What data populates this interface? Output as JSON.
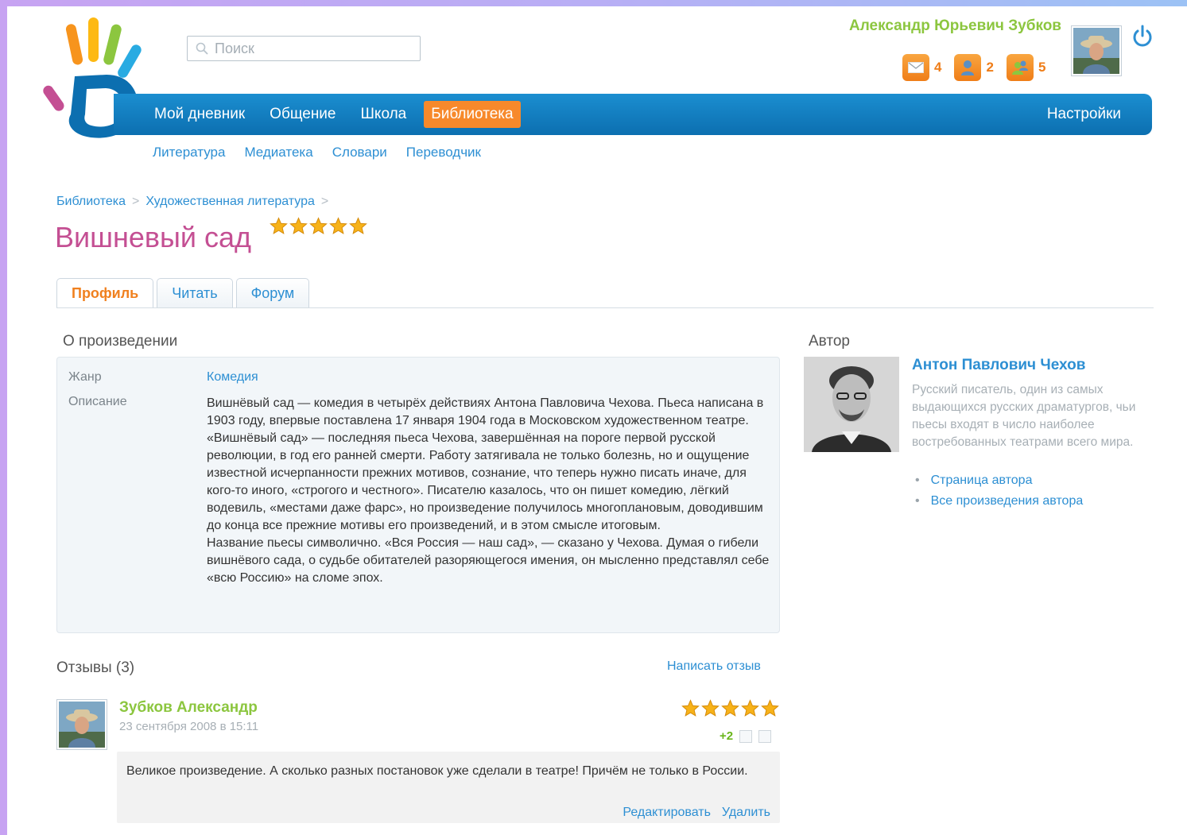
{
  "header": {
    "search_placeholder": "Поиск",
    "user_name": "Александр Юрьевич Зубков",
    "counters": [
      {
        "icon": "mail-icon",
        "count": "4"
      },
      {
        "icon": "person-icon",
        "count": "2"
      },
      {
        "icon": "people-icon",
        "count": "5"
      }
    ]
  },
  "nav": {
    "items": [
      "Мой дневник",
      "Общение",
      "Школа",
      "Библиотека"
    ],
    "active": "Библиотека",
    "settings": "Настройки"
  },
  "subnav": [
    "Литература",
    "Медиатека",
    "Словари",
    "Переводчик"
  ],
  "breadcrumb": [
    "Библиотека",
    "Художественная литература"
  ],
  "page": {
    "title": "Вишневый сад",
    "rating": 5
  },
  "tabs": [
    "Профиль",
    "Читать",
    "Форум"
  ],
  "about": {
    "section_title": "О произведении",
    "genre_label": "Жанр",
    "genre_value": "Комедия",
    "description_label": "Описание",
    "description": [
      "Вишнёвый сад — комедия в четырёх действиях Антона Павловича Чехова. Пьеса написана в 1903 году, впервые поставлена 17 января 1904 года в Московском художественном театре.",
      "«Вишнёвый сад» — последняя пьеса Чехова, завершённая на пороге первой русской революции, в год его ранней смерти. Работу затягивала не только болезнь, но и ощущение известной исчерпанности прежних мотивов, сознание, что теперь нужно писать иначе, для кого-то иного, «строгого и честного». Писателю казалось, что он пишет комедию, лёгкий водевиль, «местами даже фарс», но произведение получилось многоплановым, доводившим до конца все прежние мотивы его произведений, и в этом смысле итоговым.",
      "Название пьесы символично. «Вся Россия — наш сад», — сказано у Чехова. Думая о гибели вишнёвого сада, о судьбе обитателей разоряющегося имения, он мысленно представлял себе «всю Россию» на сломе эпох."
    ]
  },
  "author": {
    "section_title": "Автор",
    "name": "Антон Павлович Чехов",
    "description": "Русский писатель, один из самых выдающихся русских драматургов, чьи пьесы входят в число наиболее востребованных театрами всего мира.",
    "links": [
      "Страница автора",
      "Все произведения автора"
    ]
  },
  "reviews": {
    "title": "Отзывы (3)",
    "write_label": "Написать отзыв",
    "items": [
      {
        "author": "Зубков Александр",
        "date": "23 сентября 2008 в 15:11",
        "rating": 5,
        "votes": "+2",
        "text": "Великое произведение. А сколько разных постановок уже сделали в театре! Причём не только в России.",
        "edit_label": "Редактировать",
        "delete_label": "Удалить"
      }
    ]
  },
  "colors": {
    "nav_blue": "#0c6fb0",
    "accent_orange": "#f7892b",
    "link_blue": "#2d8fd3",
    "user_green": "#8cc63f",
    "title_pink": "#c44f93"
  }
}
